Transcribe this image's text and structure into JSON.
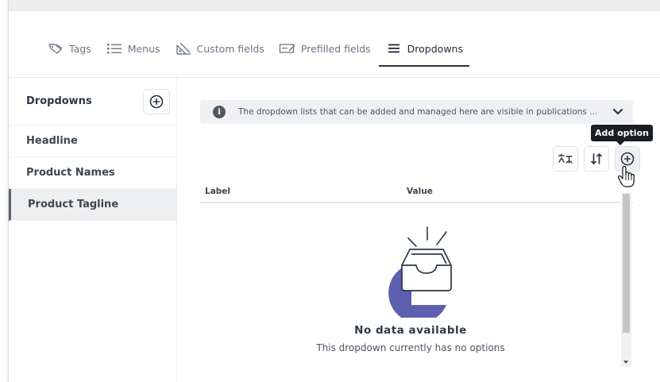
{
  "tabs": [
    {
      "label": "Tags",
      "icon": "tag-icon"
    },
    {
      "label": "Menus",
      "icon": "list-icon"
    },
    {
      "label": "Custom fields",
      "icon": "ruler-icon"
    },
    {
      "label": "Prefilled fields",
      "icon": "prefilled-field-icon"
    },
    {
      "label": "Dropdowns",
      "icon": "menu-lines-icon",
      "active": true
    }
  ],
  "sidebar": {
    "title": "Dropdowns",
    "items": [
      {
        "label": "Headline"
      },
      {
        "label": "Product Names"
      },
      {
        "label": "Product Tagline",
        "selected": true
      }
    ]
  },
  "notice": {
    "text": "The dropdown lists that can be added and managed here are visible in publications ..."
  },
  "toolbar": {
    "tooltip": "Add option"
  },
  "table": {
    "columns": [
      "Label",
      "Value"
    ]
  },
  "empty": {
    "title": "No data available",
    "subtitle": "This dropdown currently has no options"
  },
  "colors": {
    "accent": "#5e5fb0",
    "text_dark": "#2c3744",
    "notice_bg": "#eef0f3"
  }
}
